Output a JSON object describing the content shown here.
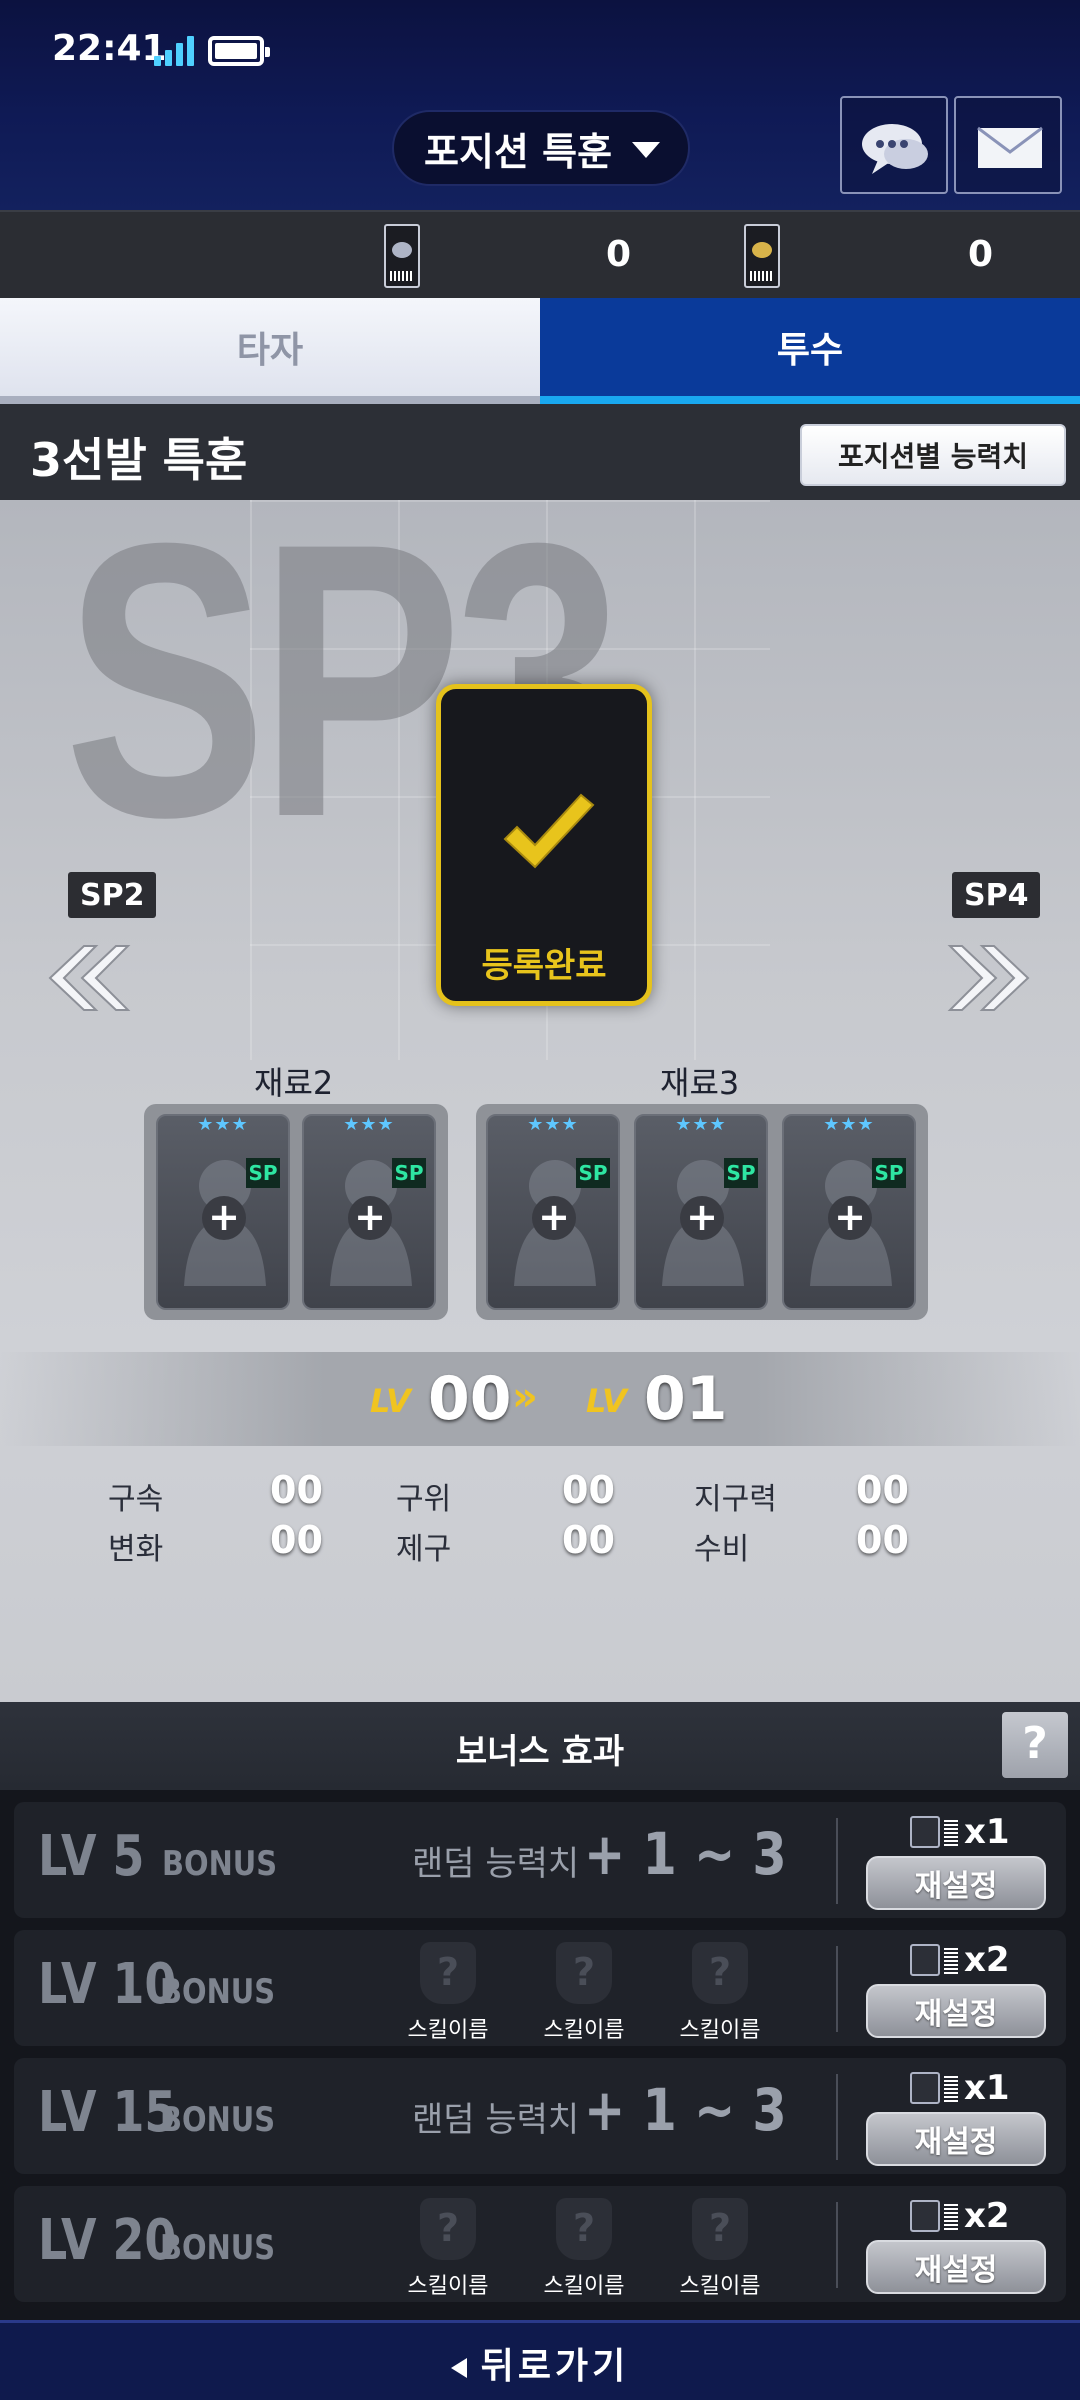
{
  "status": {
    "time": "22:41"
  },
  "header": {
    "title": "포지션 특훈"
  },
  "currency": {
    "ticket1_value": "0",
    "ticket2_value": "0"
  },
  "tabs": {
    "batter": "타자",
    "pitcher": "투수"
  },
  "section": {
    "title": "3선발 특훈",
    "ability_button": "포지션별 능력치"
  },
  "training": {
    "bg_text": "SP3",
    "done_label": "등록완료",
    "prev_label": "SP2",
    "next_label": "SP4",
    "material2_label": "재료2",
    "material3_label": "재료3",
    "card_stars": "★★★",
    "card_badge": "SP",
    "lv_tag": "LV",
    "lv_from": "00",
    "lv_to": "01",
    "lv_arrow": "»"
  },
  "stats": [
    {
      "name": "구속",
      "value": "00"
    },
    {
      "name": "구위",
      "value": "00"
    },
    {
      "name": "지구력",
      "value": "00"
    },
    {
      "name": "변화",
      "value": "00"
    },
    {
      "name": "제구",
      "value": "00"
    },
    {
      "name": "수비",
      "value": "00"
    }
  ],
  "bonus": {
    "title": "보너스 효과",
    "help": "?",
    "rows": [
      {
        "lv": "LV 5",
        "bonus": "BONUS",
        "random_text": "랜덤 능력치",
        "range": "+ 1 ~ 3",
        "cost": "x1",
        "reset": "재설정"
      },
      {
        "lv": "LV 10",
        "bonus": "BONUS",
        "skills": [
          "스킬이름",
          "스킬이름",
          "스킬이름"
        ],
        "cost": "x2",
        "reset": "재설정"
      },
      {
        "lv": "LV 15",
        "bonus": "BONUS",
        "random_text": "랜덤 능력치",
        "range": "+ 1 ~ 3",
        "cost": "x1",
        "reset": "재설정"
      },
      {
        "lv": "LV 20",
        "bonus": "BONUS",
        "skills": [
          "스킬이름",
          "스킬이름",
          "스킬이름"
        ],
        "cost": "x2",
        "reset": "재설정"
      }
    ]
  },
  "footer": {
    "back_label": "뒤로가기"
  },
  "colors": {
    "accent_blue": "#0a3a9a",
    "tab_underline": "#19a8f0",
    "gold": "#e5c21c",
    "sp_green": "#2ee6a2"
  }
}
